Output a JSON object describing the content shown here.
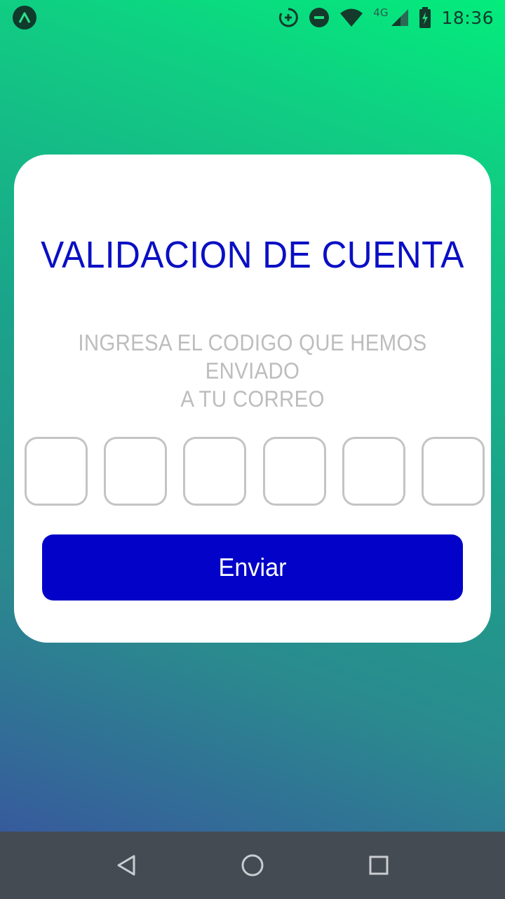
{
  "status_bar": {
    "time": "18:36",
    "network_type": "4G",
    "icons": [
      "app-launcher-icon",
      "data-saver-icon",
      "do-not-disturb-icon",
      "wifi-icon",
      "cell-signal-icon",
      "battery-charging-icon"
    ]
  },
  "card": {
    "title": "VALIDACION DE CUENTA",
    "subtitle_line1": "INGRESA EL CODIGO QUE HEMOS ENVIADO",
    "subtitle_line2": "A TU CORREO",
    "code_digits": [
      "",
      "",
      "",
      "",
      "",
      ""
    ],
    "submit_label": "Enviar"
  },
  "nav_bar": {
    "icons": [
      "back-icon",
      "home-icon",
      "recents-icon"
    ]
  },
  "colors": {
    "title": "#0a0fc4",
    "button": "#0202c8",
    "subtitle": "#bdbdbd",
    "code_border": "#c4c4c4",
    "nav_bar": "#454b53"
  }
}
